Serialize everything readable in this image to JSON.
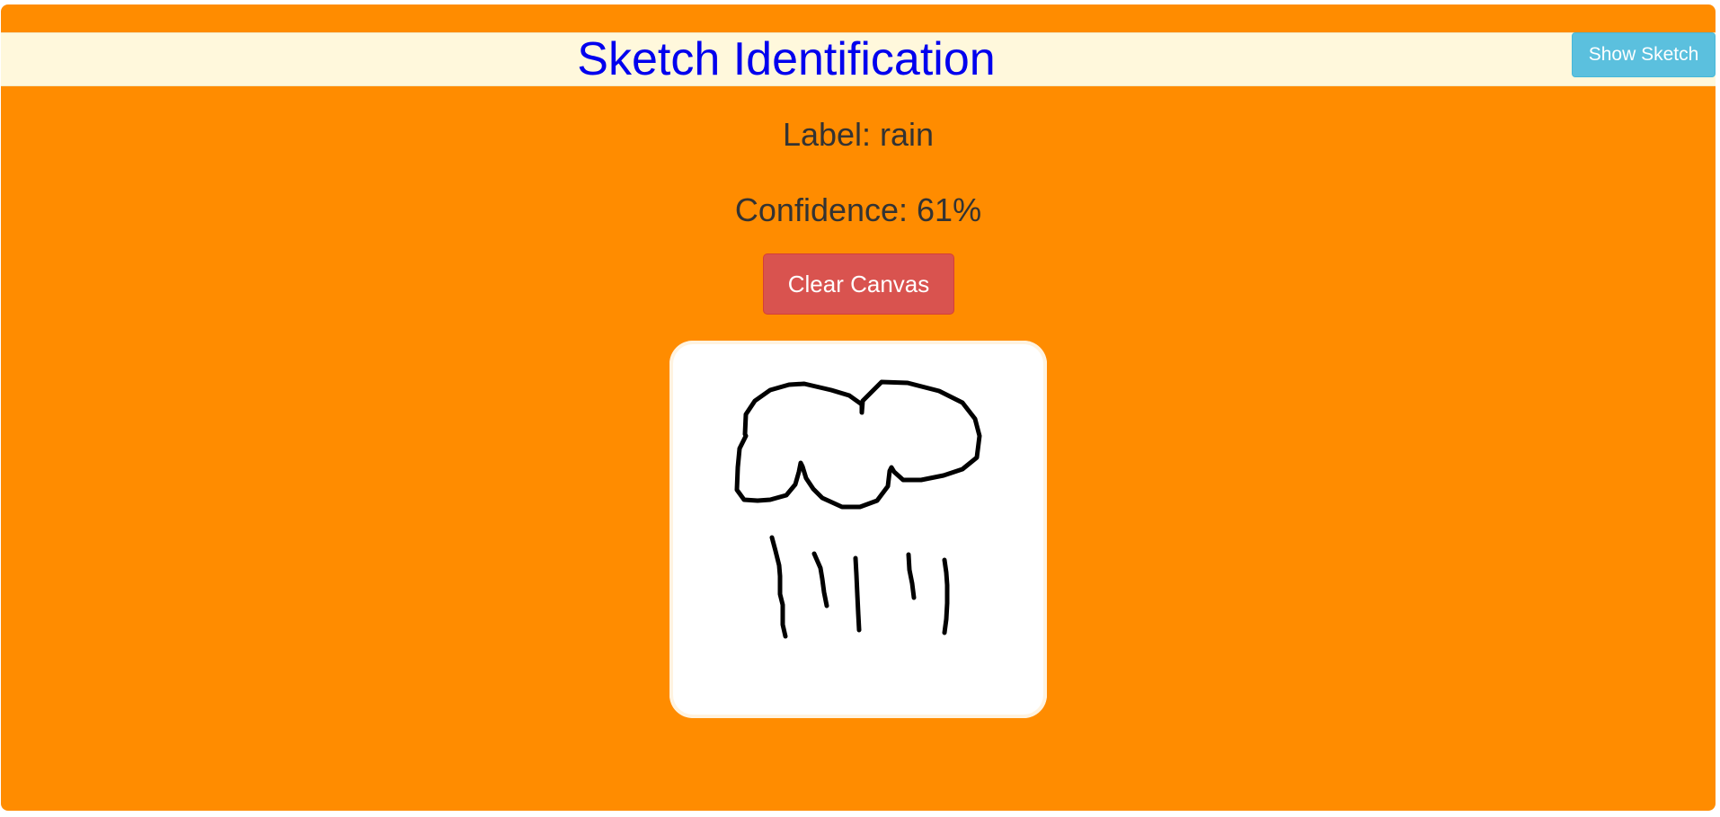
{
  "header": {
    "title": "Sketch Identification",
    "show_sketch_label": "Show Sketch"
  },
  "prediction": {
    "label_text": "Label: rain",
    "confidence_text": "Confidence: 61%"
  },
  "controls": {
    "clear_label": "Clear Canvas"
  },
  "colors": {
    "background": "#ff8c00",
    "header_bg": "#fff8dc",
    "title": "#0000ee",
    "show_sketch_button": "#5bc0de",
    "clear_button": "#d9534f",
    "canvas": "#ffffff",
    "ink": "#000000"
  }
}
